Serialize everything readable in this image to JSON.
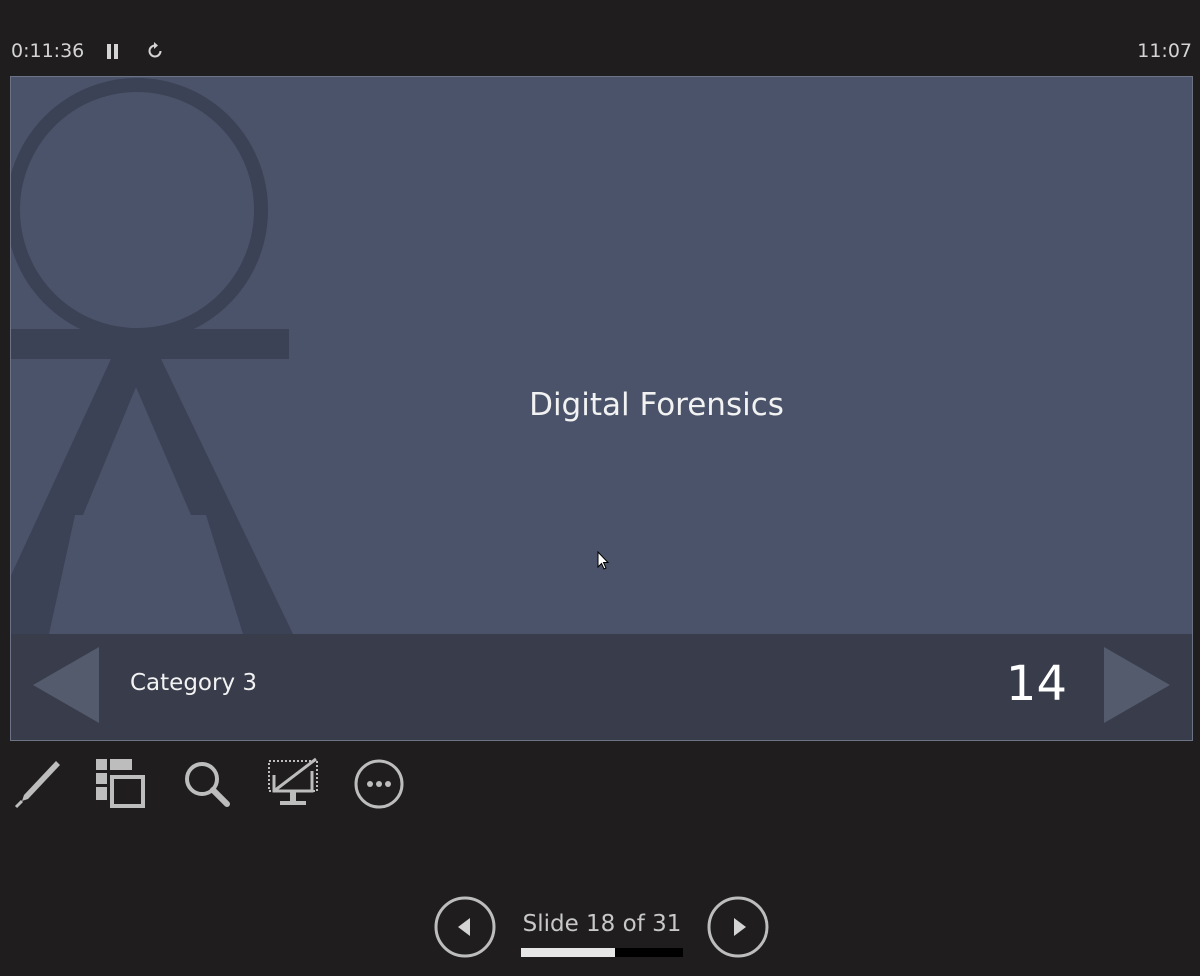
{
  "presenter": {
    "elapsed_time": "0:11:36",
    "clock": "11:07"
  },
  "slide": {
    "title": "Digital Forensics",
    "category": "Category 3",
    "number": "14",
    "background_art": "qa-letters",
    "background_color": "#4a5369",
    "footer_color": "#383c4b"
  },
  "tools": [
    {
      "name": "pen-tool",
      "icon": "pen-icon"
    },
    {
      "name": "see-all-slides",
      "icon": "slides-grid-icon"
    },
    {
      "name": "zoom",
      "icon": "magnifier-icon"
    },
    {
      "name": "black-screen",
      "icon": "screen-toggle-icon"
    },
    {
      "name": "more-options",
      "icon": "ellipsis-circle-icon"
    }
  ],
  "navigation": {
    "counter": "Slide 18 of 31",
    "current_slide": 18,
    "total_slides": 31
  }
}
